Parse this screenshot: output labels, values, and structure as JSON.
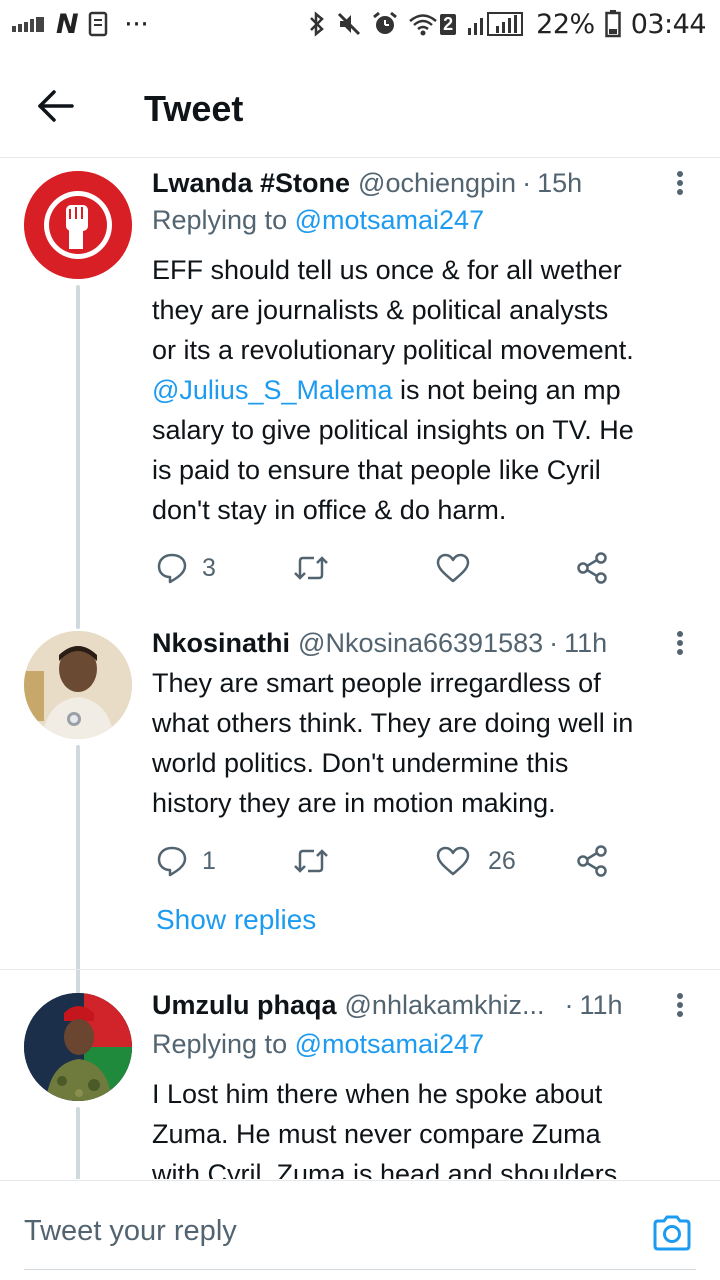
{
  "status_bar": {
    "battery": "22%",
    "time": "03:44",
    "wifi_badge": "2",
    "left_letter": "N",
    "overflow": "···"
  },
  "header": {
    "title": "Tweet"
  },
  "tweets": [
    {
      "name": "Lwanda #Stone",
      "handle": "@ochiengpin",
      "dot": "·",
      "time": "15h",
      "replying_prefix": "Replying to ",
      "replying_handle": "@motsamai247",
      "body_lines": [
        "EFF should tell us once & for all wether",
        "they are journalists & political analysts",
        "or its a revolutionary political movement."
      ],
      "mention": "@Julius_S_Malema",
      "body_after_mention": " is not being an mp",
      "body_lines_2": [
        "salary to give political insights on TV. He",
        "is paid to ensure that people like Cyril",
        "don't stay in office & do harm."
      ],
      "replies": "3",
      "retweets": "",
      "likes": ""
    },
    {
      "name": "Nkosinathi",
      "handle": "@Nkosina66391583",
      "dot": "·",
      "time": "11h",
      "body_lines": [
        "They are smart people irregardless of",
        "what others think. They are doing well in",
        "world politics. Don't undermine this",
        "history they are in motion making."
      ],
      "replies": "1",
      "retweets": "",
      "likes": "26",
      "show_replies": "Show replies"
    },
    {
      "name": "Umzulu phaqa",
      "handle": "@nhlakamkhiz...",
      "dot": "·",
      "time": "11h",
      "replying_prefix": "Replying to ",
      "replying_handle": "@motsamai247",
      "body_lines": [
        "I Lost him there when he spoke about",
        "Zuma. He must never compare Zuma",
        "with Cyril. Zuma is head and shoulders"
      ]
    }
  ],
  "compose": {
    "placeholder": "Tweet your reply"
  },
  "colors": {
    "accent": "#1d9bf0",
    "secondary_text": "#536471",
    "thread_line": "#cfd9de"
  },
  "icons": {
    "back": "arrow-left-icon",
    "more": "more-vertical-icon",
    "reply": "reply-icon",
    "retweet": "retweet-icon",
    "like": "heart-icon",
    "share": "share-icon",
    "camera": "camera-icon"
  }
}
